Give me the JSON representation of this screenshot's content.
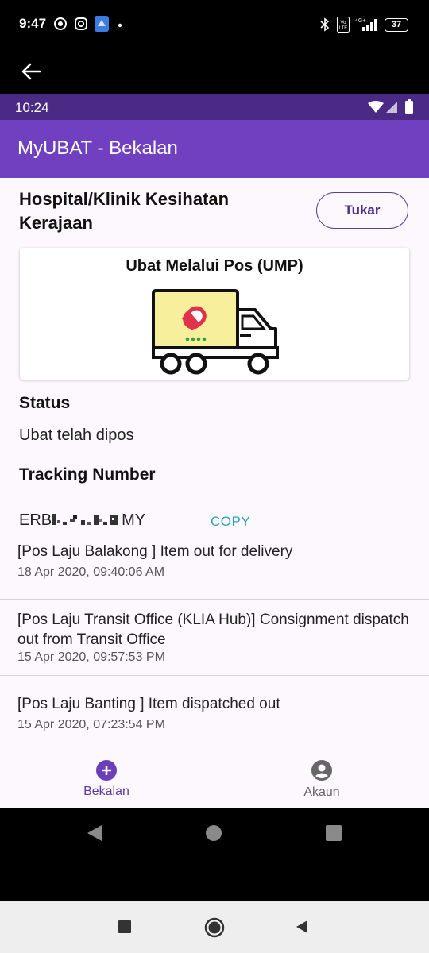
{
  "outer_status": {
    "time": "9:47",
    "battery": "37"
  },
  "inner_status": {
    "time": "10:24"
  },
  "appbar": {
    "title": "MyUBAT - Bekalan"
  },
  "facility": {
    "name": "Hospital/Klinik Kesihatan Kerajaan",
    "change_label": "Tukar"
  },
  "card": {
    "title": "Ubat Melalui Pos (UMP)"
  },
  "status": {
    "label": "Status",
    "value": "Ubat telah dipos"
  },
  "tracking": {
    "label": "Tracking Number",
    "prefix": "ERB",
    "suffix": "MY",
    "copy_label": "COPY"
  },
  "events": [
    {
      "title": "[Pos Laju Balakong ] Item out for delivery",
      "date": "18 Apr 2020, 09:40:06 AM"
    },
    {
      "title": "[Pos Laju Transit Office (KLIA Hub)] Consignment dispatch out from Transit Office",
      "date": "15 Apr 2020, 09:57:53 PM"
    },
    {
      "title": "[Pos Laju Banting ] Item dispatched out",
      "date": "15 Apr 2020, 07:23:54 PM"
    }
  ],
  "bottom_nav": {
    "items": [
      {
        "label": "Bekalan",
        "icon": "plus-circle-icon",
        "active": true
      },
      {
        "label": "Akaun",
        "icon": "account-circle-icon",
        "active": false
      }
    ]
  },
  "colors": {
    "appbar": "#7040c0",
    "inner_status": "#4b2a86",
    "accent": "#5b3aa0",
    "copy": "#2d9fb8"
  }
}
